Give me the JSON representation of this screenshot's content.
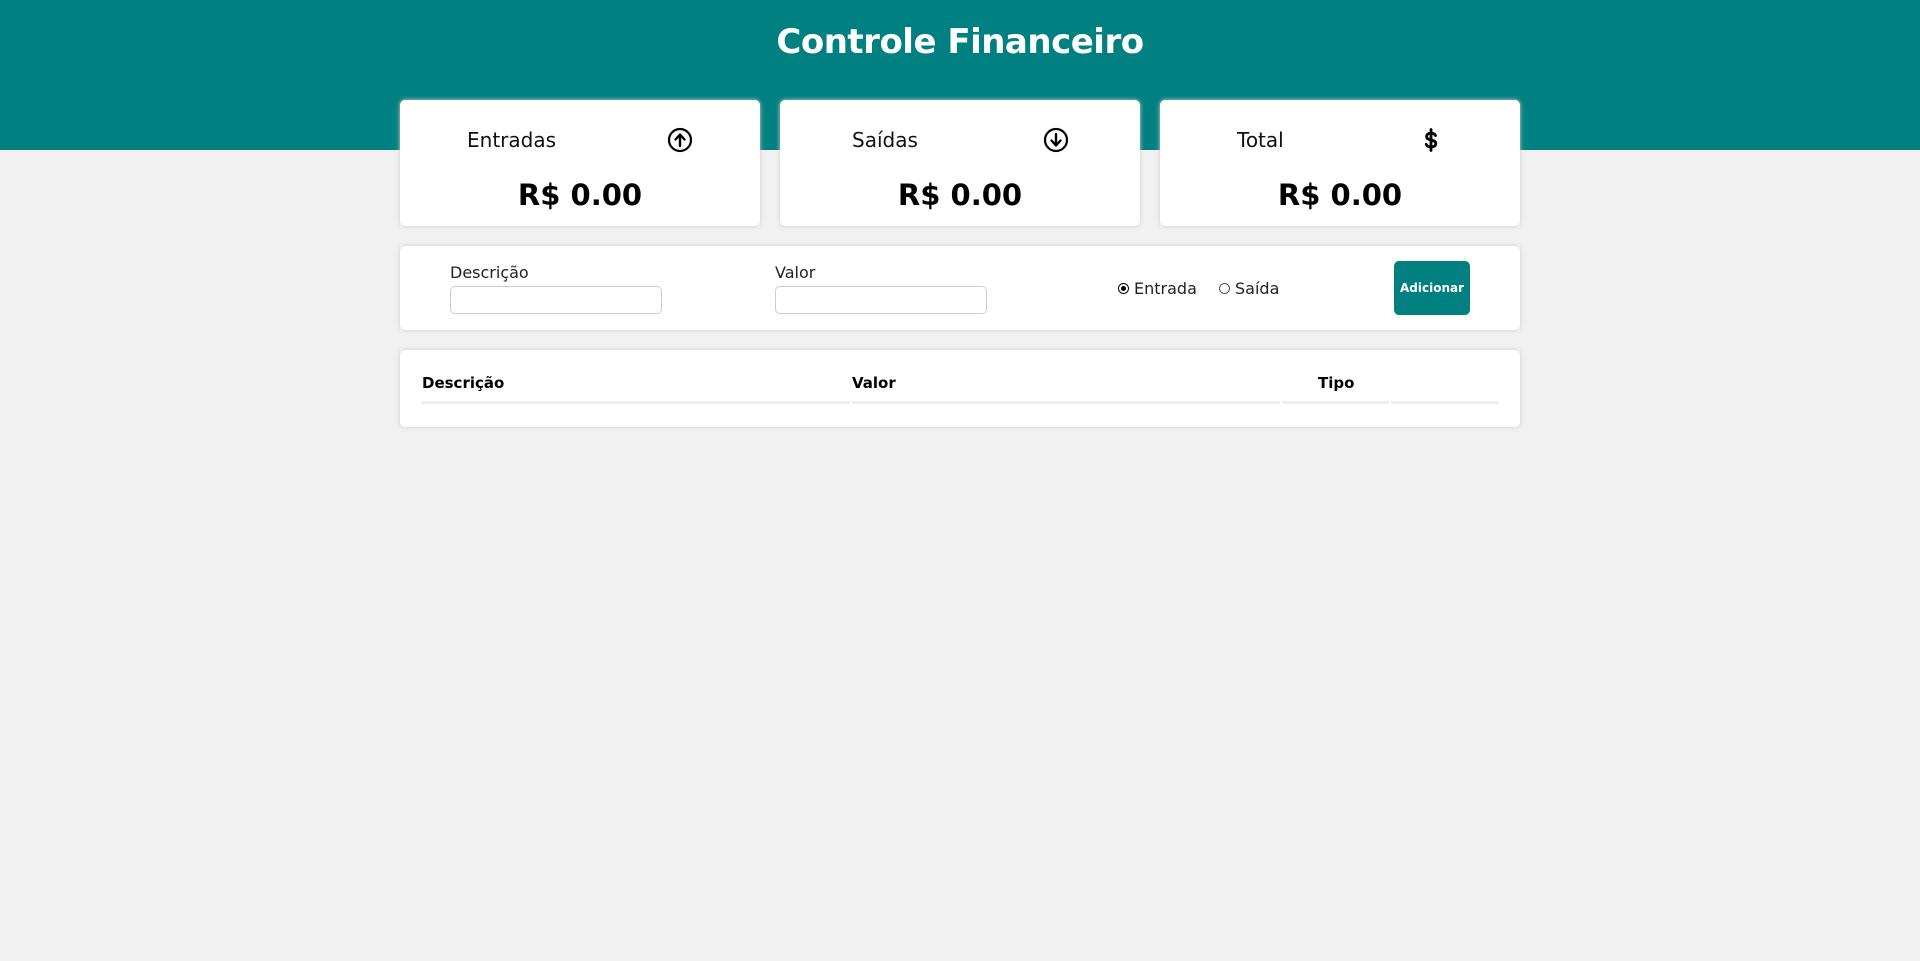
{
  "header": {
    "title": "Controle Financeiro",
    "color": "#008080"
  },
  "cards": [
    {
      "label": "Entradas",
      "icon": "arrow-up-circle-icon",
      "value": "R$ 0.00"
    },
    {
      "label": "Saídas",
      "icon": "arrow-down-circle-icon",
      "value": "R$ 0.00"
    },
    {
      "label": "Total",
      "icon": "dollar-icon",
      "value": "R$ 0.00"
    }
  ],
  "form": {
    "description_label": "Descrição",
    "description_value": "",
    "amount_label": "Valor",
    "amount_value": "",
    "type_options": [
      {
        "label": "Entrada",
        "checked": true
      },
      {
        "label": "Saída",
        "checked": false
      }
    ],
    "add_button_label": "Adicionar"
  },
  "table": {
    "columns": [
      "Descrição",
      "Valor",
      "Tipo",
      ""
    ],
    "rows": []
  }
}
